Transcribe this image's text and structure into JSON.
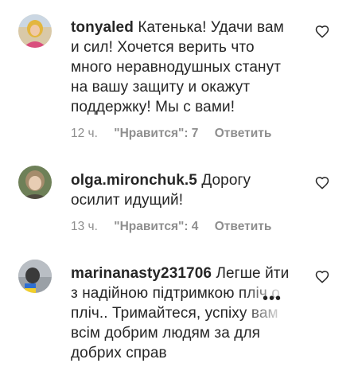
{
  "comments": [
    {
      "username": "tonyaled",
      "text": "Катенька! Удачи вам и сил! Хочется верить что много неравнодушных станут на вашу защиту и окажут поддержку! Мы с вами!",
      "lines": [
        "Катенька! Удачи вам",
        "и сил! Хочется верить что",
        "много неравнодушных станут",
        "на вашу защиту и окажут",
        "поддержку! Мы с вами!"
      ],
      "time": "12 ч.",
      "likes": "\"Нравится\": 7",
      "reply": "Ответить",
      "like_icon": "heart-outline-icon"
    },
    {
      "username": "olga.mironchuk.5",
      "text": "Дорогу осилит идущий!",
      "lines": [
        "Дорогу",
        "осилит идущий!"
      ],
      "time": "13 ч.",
      "likes": "\"Нравится\": 4",
      "reply": "Ответить",
      "like_icon": "heart-outline-icon"
    },
    {
      "username": "marinanasty231706",
      "text": "Легше йти з надійною підтримкою пліч о пліч.. Тримайтеся, успіху вам всім добрим людям за для добрих справ",
      "lines": [
        "Легше йти",
        "з надійною підтримкою пліч о",
        "пліч.. Тримайтеся, успіху вам",
        "всім добрим людям за для",
        "добрих справ"
      ],
      "more_icon": "more-dots-icon",
      "like_icon": "heart-outline-icon"
    }
  ],
  "colors": {
    "text": "#262626",
    "secondary": "#8e8e8e",
    "background": "#ffffff"
  }
}
